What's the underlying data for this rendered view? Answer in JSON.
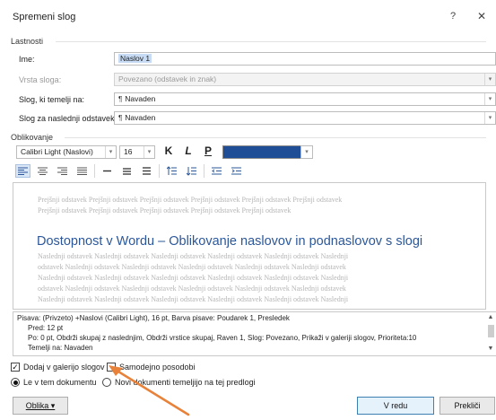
{
  "window": {
    "title": "Spremeni slog",
    "help_glyph": "?",
    "close_glyph": "✕"
  },
  "properties": {
    "group_label": "Lastnosti",
    "name_label": "Ime:",
    "name_value": "Naslov 1",
    "style_type_label": "Vrsta sloga:",
    "style_type_value": "Povezano (odstavek in znak)",
    "based_on_label": "Slog, ki temelji na:",
    "based_on_value": "Navaden",
    "next_style_label": "Slog za naslednji odstavek:",
    "next_style_value": "Navaden",
    "para_mark": "¶"
  },
  "formatting": {
    "group_label": "Oblikovanje",
    "font_value": "Calibri Light (Naslovi)",
    "size_value": "16",
    "bold_label": "K",
    "italic_label": "L",
    "underline_label": "P",
    "font_color": "#1f4e96"
  },
  "preview": {
    "previous_line_1": "Prejšnji odstavek Prejšnji odstavek Prejšnji odstavek Prejšnji odstavek Prejšnji odstavek Prejšnji odstavek",
    "previous_line_2": "Prejšnji odstavek Prejšnji odstavek Prejšnji odstavek Prejšnji odstavek Prejšnji odstavek",
    "heading": "Dostopnost v Wordu – Oblikovanje naslovov in podnaslovov s slogi",
    "next_line_1": "Naslednji odstavek Naslednji odstavek Naslednji odstavek Naslednji odstavek Naslednji odstavek Naslednji",
    "next_line_2": "odstavek Naslednji odstavek Naslednji odstavek Naslednji odstavek Naslednji odstavek Naslednji odstavek",
    "next_line_3": "Naslednji odstavek Naslednji odstavek Naslednji odstavek Naslednji odstavek Naslednji odstavek Naslednji",
    "next_line_4": "odstavek Naslednji odstavek Naslednji odstavek Naslednji odstavek Naslednji odstavek Naslednji odstavek",
    "next_line_5": "Naslednji odstavek Naslednji odstavek Naslednji odstavek Naslednji odstavek Naslednji odstavek Naslednji"
  },
  "description": {
    "line_1": "Pisava: (Privzeto) +Naslovi (Calibri Light), 16 pt, Barva pisave: Poudarek 1, Presledek",
    "line_2": "Pred: 12 pt",
    "line_3": "Po: 0 pt, Obdrži skupaj z naslednjim, Obdrži vrstice skupaj, Raven 1, Slog: Povezano, Prikaži v galeriji slogov, Prioriteta:10",
    "line_4": "Temelji na: Navaden"
  },
  "options": {
    "add_to_gallery_label": "Dodaj v galerijo slogov",
    "add_to_gallery_checked": true,
    "auto_update_label": "Samodejno posodobi",
    "auto_update_checked": false,
    "only_this_doc_label": "Le v tem dokumentu",
    "new_docs_label": "Novi dokumenti temeljijo na tej predlogi"
  },
  "buttons": {
    "format_label": "Oblika ▾",
    "ok_label": "V redu",
    "cancel_label": "Prekliči"
  },
  "colors": {
    "accent": "#2b579a",
    "annotation_arrow": "#e8823a"
  }
}
